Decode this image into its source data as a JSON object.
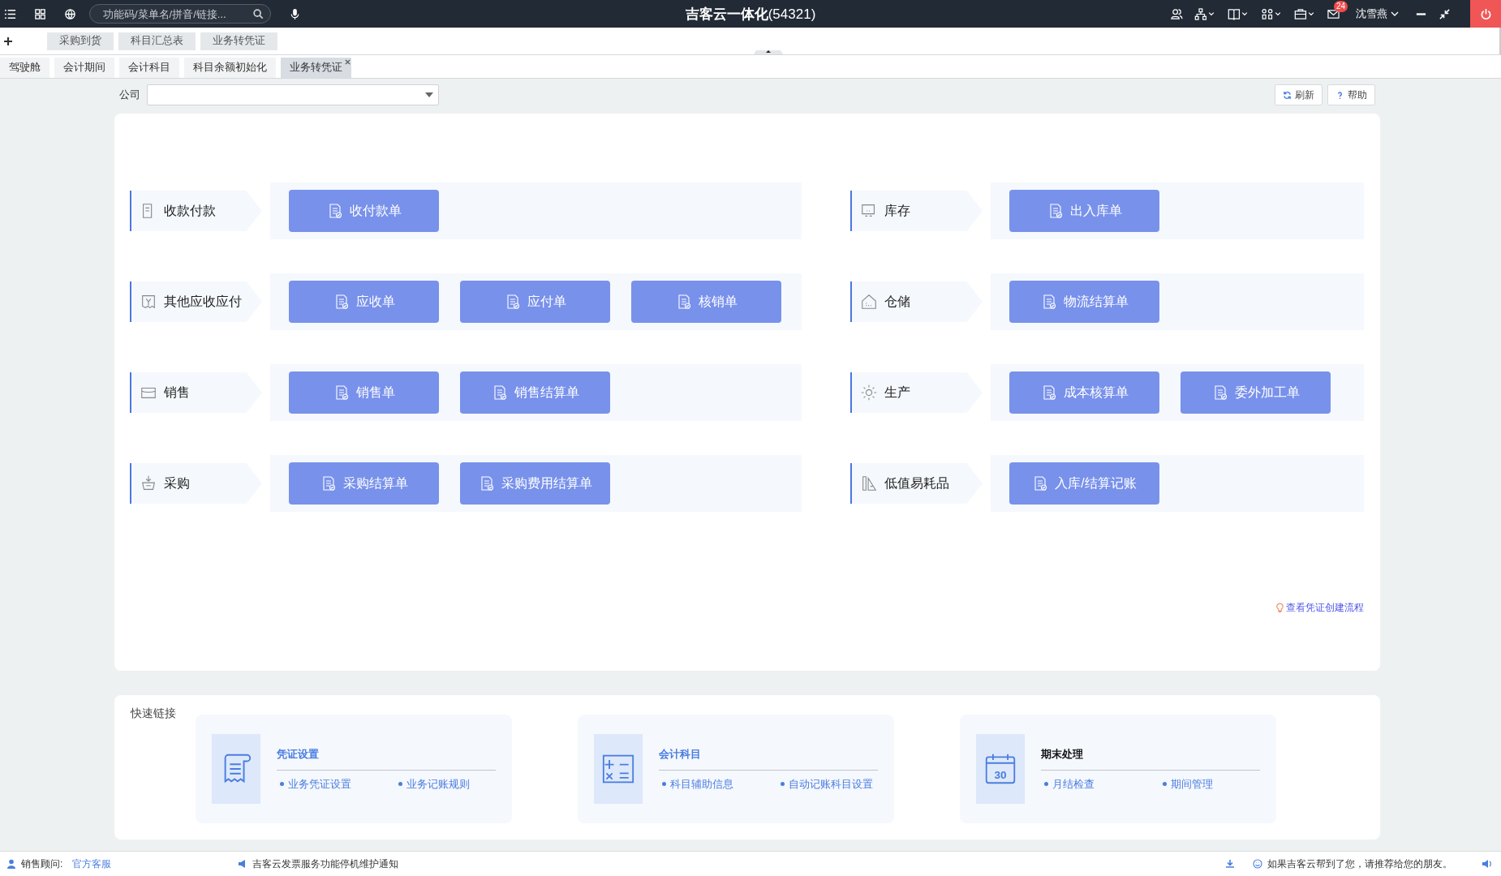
{
  "topbar": {
    "title": "吉客云一体化",
    "title_code": "(54321)",
    "search": {
      "placeholder": "功能码/菜单名/拼音/链接..."
    },
    "mail_badge": "24",
    "user": "沈雪燕"
  },
  "shortcuts": [
    "采购到货",
    "科目汇总表",
    "业务转凭证"
  ],
  "tabs": [
    {
      "label": "驾驶舱",
      "selected": false
    },
    {
      "label": "会计期间",
      "selected": false
    },
    {
      "label": "会计科目",
      "selected": false
    },
    {
      "label": "科目余额初始化",
      "selected": false
    },
    {
      "label": "业务转凭证",
      "selected": true
    }
  ],
  "company": {
    "label": "公司"
  },
  "toolbar": [
    {
      "label": "刷新",
      "kind": "refresh"
    },
    {
      "label": "帮助",
      "kind": "help"
    }
  ],
  "columns": [
    [
      {
        "category": "收款付款",
        "kind": "payment",
        "buttons": [
          "收付款单"
        ]
      },
      {
        "category": "其他应收应付",
        "kind": "receipt",
        "buttons": [
          "应收单",
          "应付单",
          "核销单"
        ]
      },
      {
        "category": "销售",
        "kind": "sales",
        "buttons": [
          "销售单",
          "销售结算单"
        ]
      },
      {
        "category": "采购",
        "kind": "purchase",
        "buttons": [
          "采购结算单",
          "采购费用结算单"
        ]
      }
    ],
    [
      {
        "category": "库存",
        "kind": "inventory",
        "buttons": [
          "出入库单"
        ]
      },
      {
        "category": "仓储",
        "kind": "warehouse",
        "buttons": [
          "物流结算单"
        ]
      },
      {
        "category": "生产",
        "kind": "production",
        "buttons": [
          "成本核算单",
          "委外加工单"
        ]
      },
      {
        "category": "低值易耗品",
        "kind": "consumables",
        "buttons": [
          "入库/结算记账"
        ]
      }
    ]
  ],
  "flow_link": "查看凭证创建流程",
  "quick_links": {
    "title": "快速链接",
    "cards": [
      {
        "title": "凭证设置",
        "kind": "voucher",
        "selected": false,
        "links": [
          "业务凭证设置",
          "业务记账规则"
        ]
      },
      {
        "title": "会计科目",
        "kind": "ledger",
        "selected": false,
        "links": [
          "科目辅助信息",
          "自动记账科目设置"
        ]
      },
      {
        "title": "期末处理",
        "kind": "calendar",
        "icon_text": "30",
        "selected": true,
        "links": [
          "月结检查",
          "期间管理"
        ]
      }
    ]
  },
  "footer": {
    "advisor_label": "销售顾问:",
    "advisor_link": "官方客服",
    "notice": "吉客云发票服务功能停机维护通知",
    "recommend": "如果吉客云帮到了您，请推荐给您的朋友。"
  }
}
